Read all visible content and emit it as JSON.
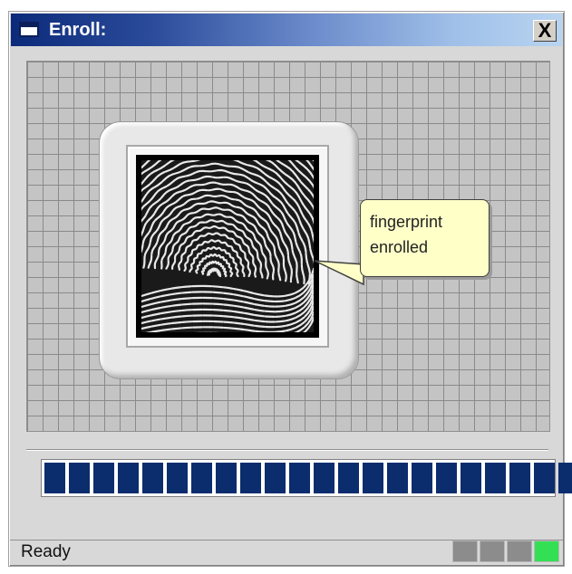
{
  "window": {
    "title": "Enroll:",
    "close_label": "X"
  },
  "callout": {
    "line1": "fingerprint",
    "line2": "enrolled"
  },
  "progress": {
    "fraction": 1.0,
    "segments": 22,
    "color": "#0b2d6e"
  },
  "status": {
    "text": "Ready",
    "indicators": [
      {
        "color": "#8c8c8c"
      },
      {
        "color": "#8c8c8c"
      },
      {
        "color": "#8c8c8c"
      },
      {
        "color": "#33e054"
      }
    ]
  },
  "icons": {
    "window_icon": "window-icon",
    "close_icon": "close-icon",
    "fingerprint": "fingerprint-image"
  }
}
